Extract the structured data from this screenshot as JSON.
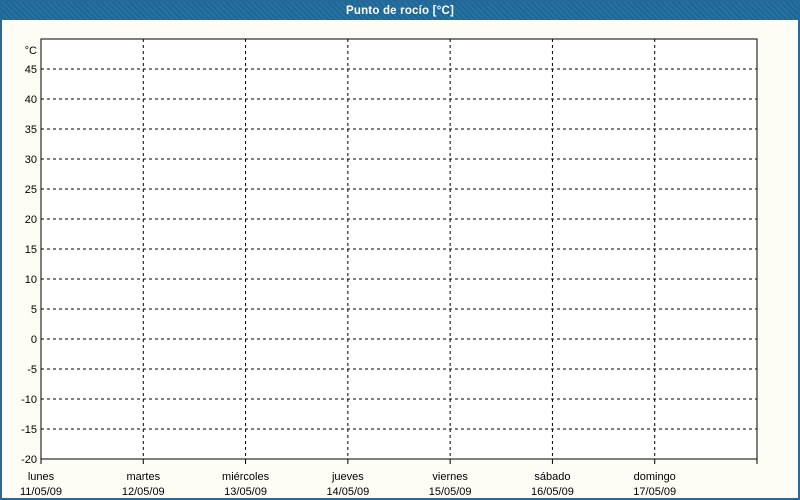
{
  "window": {
    "title": "Punto de rocío [°C]"
  },
  "theme": {
    "header_bg": "#1d6a9b",
    "page_border": "#27689b",
    "page_bg": "#fdfdf6",
    "plot_bg": "#ffffff",
    "grid_color": "#000000",
    "axis_color": "#000000",
    "label_color": "#000000",
    "title_color": "#ffffff"
  },
  "chart_data": {
    "type": "line",
    "title": "Punto de rocío [°C]",
    "ylabel": "°C",
    "ylim": [
      -20,
      50
    ],
    "ytick_step": 5,
    "yticks": [
      45,
      40,
      35,
      30,
      25,
      20,
      15,
      10,
      5,
      0,
      -5,
      -10,
      -15,
      -20
    ],
    "x_categories": [
      {
        "day": "lunes",
        "date": "11/05/09"
      },
      {
        "day": "martes",
        "date": "12/05/09"
      },
      {
        "day": "miércoles",
        "date": "13/05/09"
      },
      {
        "day": "jueves",
        "date": "14/05/09"
      },
      {
        "day": "viernes",
        "date": "15/05/09"
      },
      {
        "day": "sábado",
        "date": "16/05/09"
      },
      {
        "day": "domingo",
        "date": "17/05/09"
      }
    ],
    "series": [],
    "grid": "dashed",
    "legend_position": "none"
  }
}
